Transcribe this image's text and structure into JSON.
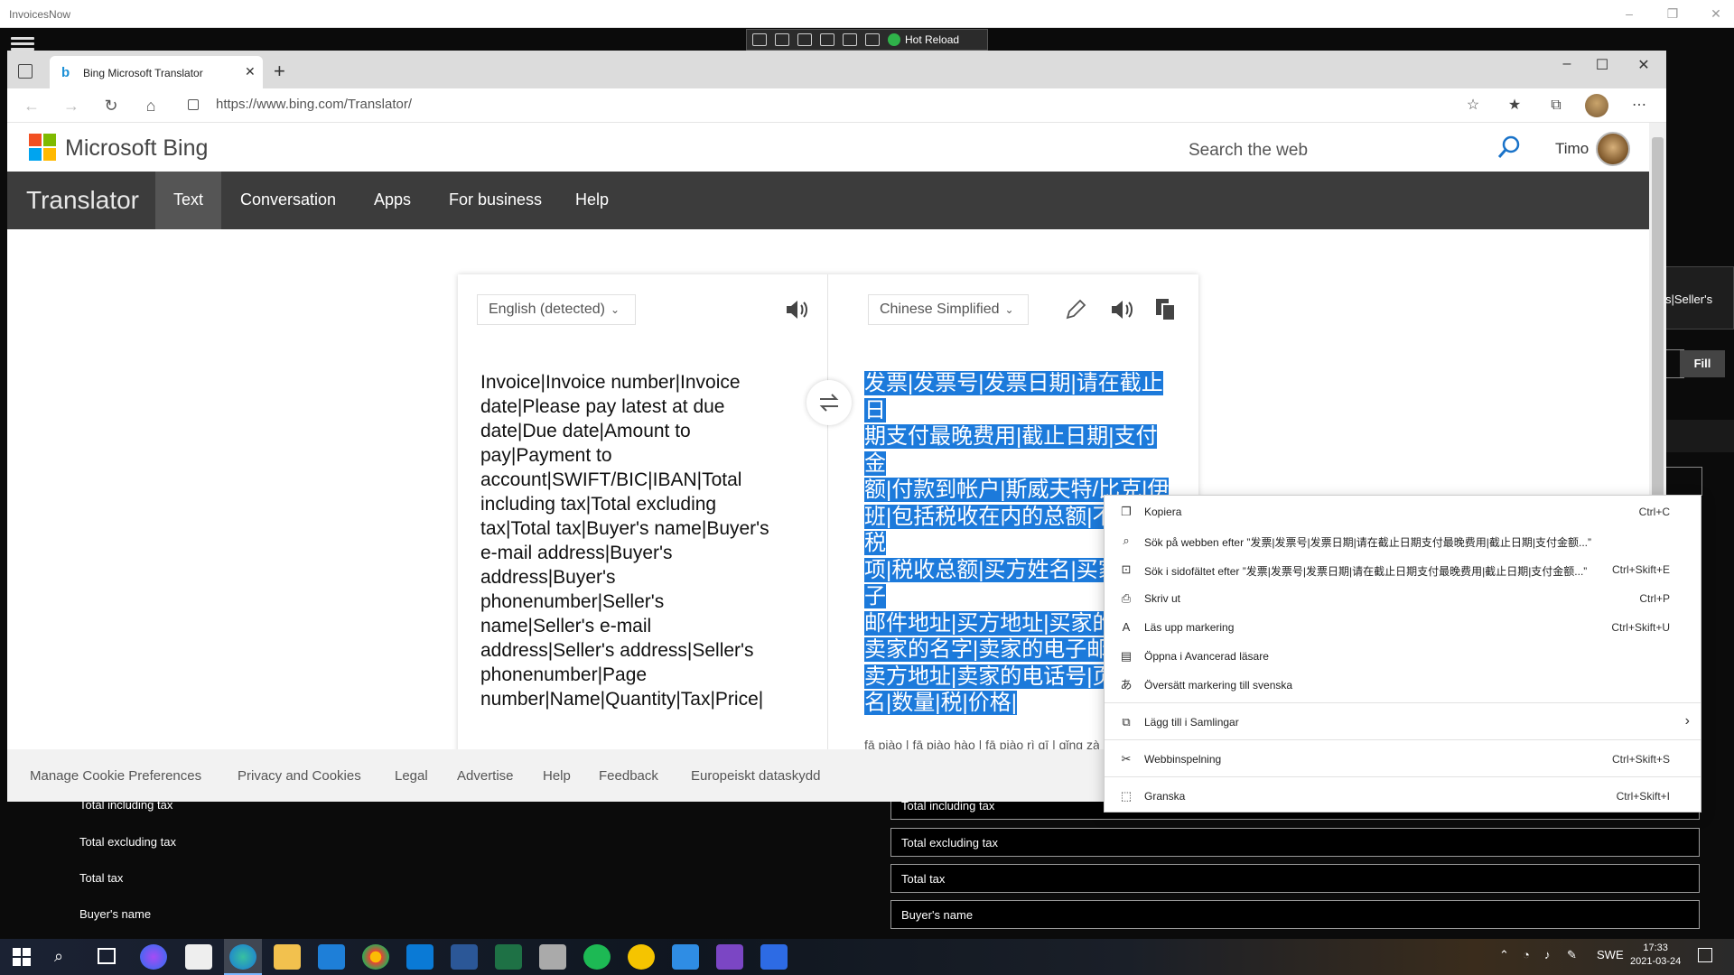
{
  "app": {
    "title": "InvoicesNow"
  },
  "devtools": {
    "hot_reload_label": "Hot Reload"
  },
  "browser": {
    "tab_title": "Bing Microsoft Translator",
    "url": "https://www.bing.com/Translator/"
  },
  "bing": {
    "brand": "Microsoft Bing",
    "search_placeholder": "Search the web",
    "user_name": "Timo"
  },
  "nav": {
    "title": "Translator",
    "items": [
      "Text",
      "Conversation",
      "Apps",
      "For business",
      "Help"
    ]
  },
  "translator": {
    "source_lang": "English (detected)",
    "target_lang": "Chinese Simplified",
    "source_text": "Invoice|Invoice number|Invoice date|Please pay latest at due date|Due date|Amount to pay|Payment to account|SWIFT/BIC|IBAN|Total including tax|Total excluding tax|Total tax|Buyer's name|Buyer's e-mail address|Buyer's address|Buyer's phonenumber|Seller's name|Seller's e-mail address|Seller's address|Seller's phonenumber|Page number|Name|Quantity|Tax|Price|",
    "target_lines": [
      "发票|发票号|发票日期|请在截止日",
      "期支付最晚费用|截止日期|支付金",
      "额|付款到帐户|斯威夫特/比克|伊",
      "班|包括税收在内的总额|不包括税",
      "项|税收总额|买方姓名|买家的电子",
      "邮件地址|买方地址|买家的",
      "卖家的名字|卖家的电子邮",
      "卖方地址|卖家的电话号|页",
      "名|数量|税|价格|"
    ],
    "pinyin": "fā piào | fā piào hào | fā piào rì qī | qǐng zài jié zhǐ rì qī zhī fù zuì wǎn fèi yòng | jié zhǐ rì qī | zhī fù jīn é | fù kuǎn dào zhàng hù | sī wēi fū tè / bǐ kè |"
  },
  "footer": {
    "links": [
      "Manage Cookie Preferences",
      "Privacy and Cookies",
      "Legal",
      "Advertise",
      "Help",
      "Feedback",
      "Europeiskt dataskydd"
    ]
  },
  "context_menu": {
    "items": [
      {
        "icon": "copy-icon",
        "label": "Kopiera",
        "shortcut": "Ctrl+C"
      },
      {
        "icon": "search-icon",
        "label": "Sök på webben efter ”发票|发票号|发票日期|请在截止日期支付最晚费用|截止日期|支付金额...”",
        "shortcut": ""
      },
      {
        "icon": "sidebar-search-icon",
        "label": "Sök i sidofältet efter ”发票|发票号|发票日期|请在截止日期支付最晚费用|截止日期|支付金额...”",
        "shortcut": "Ctrl+Skift+E"
      },
      {
        "icon": "print-icon",
        "label": "Skriv ut",
        "shortcut": "Ctrl+P"
      },
      {
        "icon": "read-aloud-icon",
        "label": "Läs upp markering",
        "shortcut": "Ctrl+Skift+U"
      },
      {
        "icon": "reader-icon",
        "label": "Öppna i Avancerad läsare",
        "shortcut": ""
      },
      {
        "icon": "translate-icon",
        "label": "Översätt markering till svenska",
        "shortcut": ""
      },
      {
        "icon": "collections-icon",
        "label": "Lägg till i Samlingar",
        "shortcut": ""
      },
      {
        "icon": "capture-icon",
        "label": "Webbinspelning",
        "shortcut": "Ctrl+Skift+S"
      },
      {
        "icon": "inspect-icon",
        "label": "Granska",
        "shortcut": "Ctrl+Skift+I"
      }
    ]
  },
  "underlying_form": {
    "right_partial_text": "s|Seller's",
    "fill_button": "Fill",
    "rows": [
      {
        "label": "Total including tax",
        "value": "Total including tax"
      },
      {
        "label": "Total excluding tax",
        "value": "Total excluding tax"
      },
      {
        "label": "Total tax",
        "value": "Total tax"
      },
      {
        "label": "Buyer's name",
        "value": "Buyer's name"
      }
    ]
  },
  "taskbar": {
    "lang": "SWE",
    "time": "17:33",
    "date": "2021-03-24"
  }
}
